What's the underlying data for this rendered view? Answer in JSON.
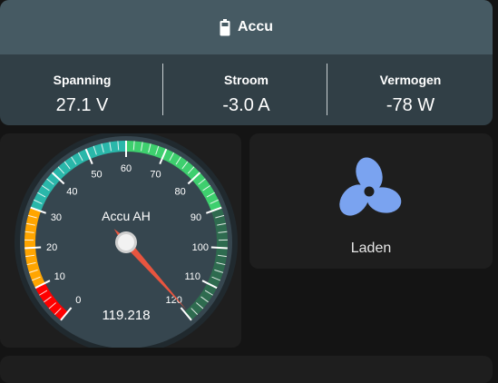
{
  "accu": {
    "title": "Accu",
    "icon": "battery-icon",
    "stats": [
      {
        "label": "Spanning",
        "value": "27.1 V"
      },
      {
        "label": "Stroom",
        "value": "-3.0 A"
      },
      {
        "label": "Vermogen",
        "value": "-78 W"
      }
    ]
  },
  "gauge": {
    "title": "Accu AH",
    "value_text": "119.218",
    "value": 119.218,
    "min": 0,
    "max": 120,
    "tick_labels": [
      "0",
      "10",
      "20",
      "30",
      "40",
      "50",
      "60",
      "70",
      "80",
      "90",
      "100",
      "110",
      "120"
    ],
    "zones": [
      {
        "from": 0,
        "to": 10,
        "color": "#ff0000"
      },
      {
        "from": 10,
        "to": 30,
        "color": "#ffa500"
      },
      {
        "from": 30,
        "to": 60,
        "color": "#2ab7aa"
      },
      {
        "from": 60,
        "to": 90,
        "color": "#3ecf6e"
      },
      {
        "from": 90,
        "to": 120,
        "color": "#2e6b4f"
      }
    ]
  },
  "fan": {
    "label": "Laden",
    "icon": "fan-icon",
    "color": "#7aa3f0"
  }
}
